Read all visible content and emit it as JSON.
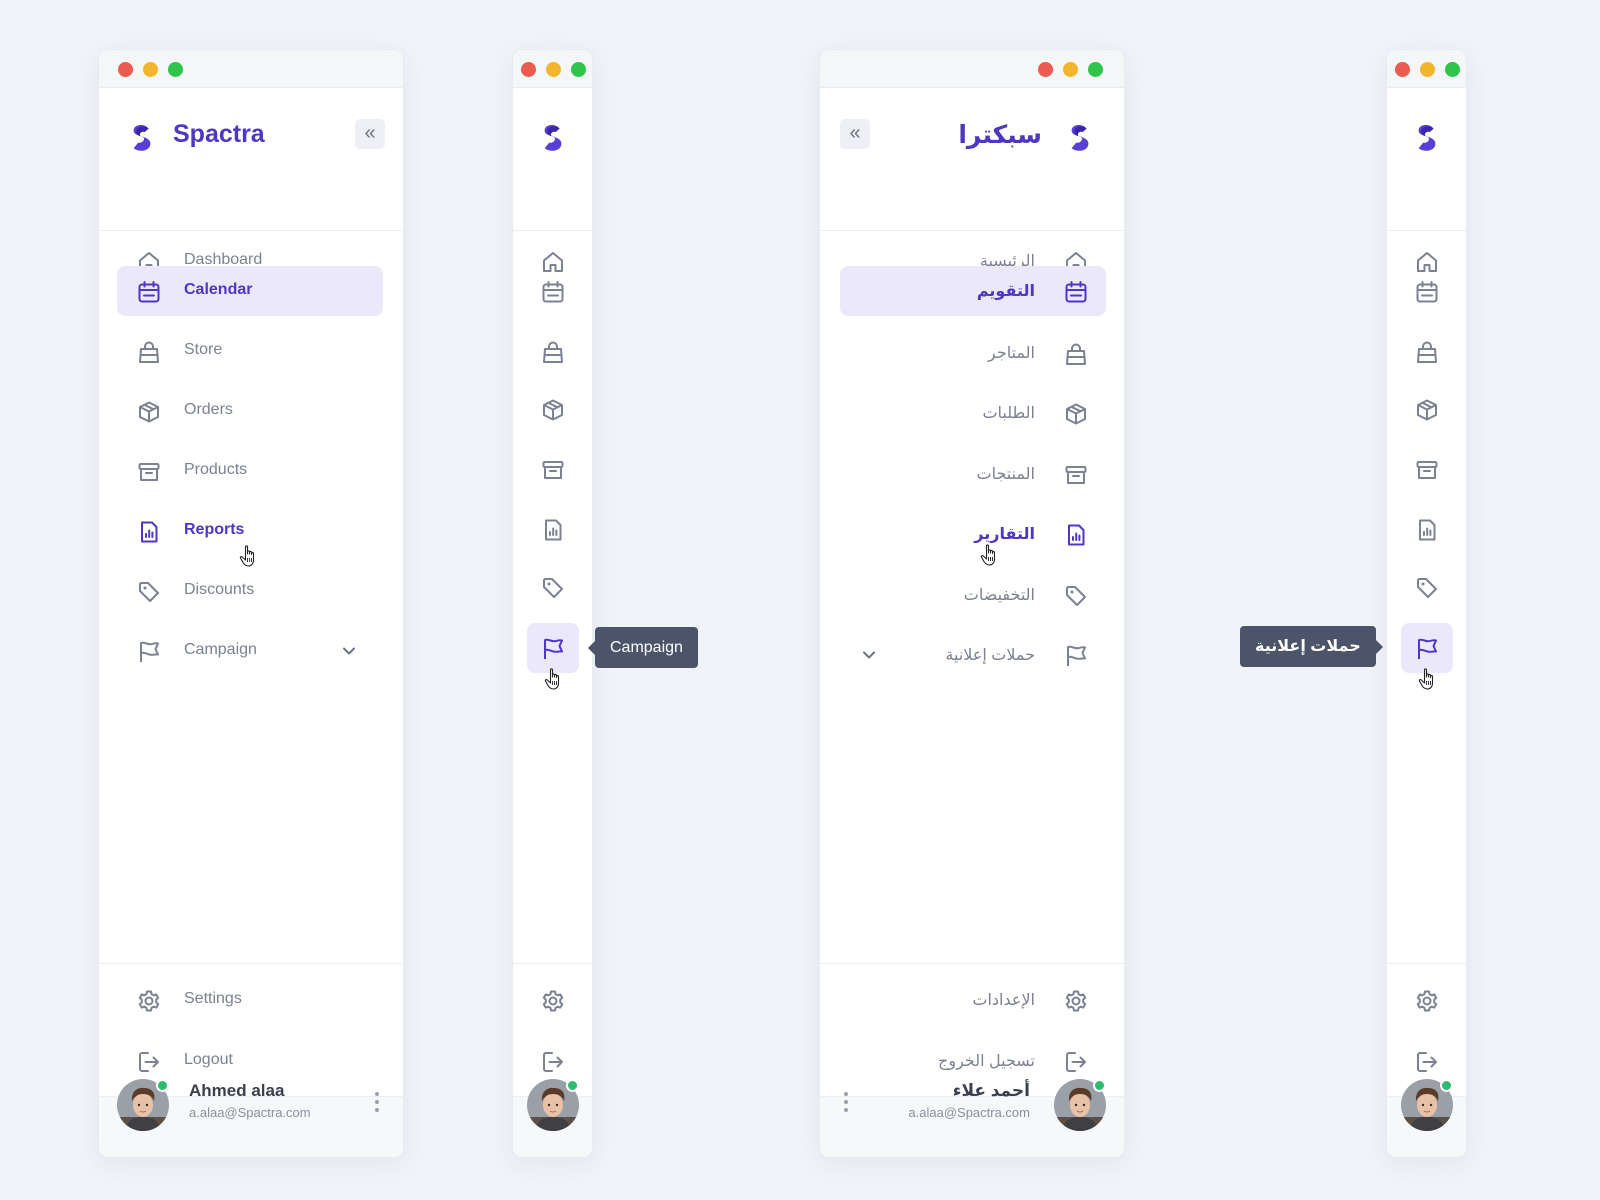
{
  "colors": {
    "accent": "#4c38c4",
    "active_bg": "#ebe8fc",
    "text_muted": "#7c8193",
    "online": "#2bbd6b",
    "tooltip_bg": "#4b5468"
  },
  "en": {
    "brand": "Spactra",
    "nav": [
      {
        "label": "Dashboard",
        "icon": "home-icon"
      },
      {
        "label": "Calendar",
        "icon": "calendar-icon"
      },
      {
        "label": "Store",
        "icon": "shopping-bag-icon"
      },
      {
        "label": "Orders",
        "icon": "box-icon"
      },
      {
        "label": "Products",
        "icon": "archive-icon"
      },
      {
        "label": "Reports",
        "icon": "report-icon"
      },
      {
        "label": "Discounts",
        "icon": "tag-icon"
      },
      {
        "label": "Campaign",
        "icon": "flag-icon"
      }
    ],
    "footer": [
      {
        "label": "Settings",
        "icon": "gear-icon"
      },
      {
        "label": "Logout",
        "icon": "logout-icon"
      }
    ],
    "user": {
      "name": "Ahmed alaa",
      "email": "a.alaa@Spactra.com"
    },
    "tooltip": "Campaign"
  },
  "ar": {
    "brand": "سبكترا",
    "nav": [
      {
        "label": "الرئيسية",
        "icon": "home-icon"
      },
      {
        "label": "التقويم",
        "icon": "calendar-icon"
      },
      {
        "label": "المتاجر",
        "icon": "shopping-bag-icon"
      },
      {
        "label": "الطلبات",
        "icon": "box-icon"
      },
      {
        "label": "المنتجات",
        "icon": "archive-icon"
      },
      {
        "label": "التقارير",
        "icon": "report-icon"
      },
      {
        "label": "التخفيضات",
        "icon": "tag-icon"
      },
      {
        "label": "حملات إعلانية",
        "icon": "flag-icon"
      }
    ],
    "footer": [
      {
        "label": "الإعدادات",
        "icon": "gear-icon"
      },
      {
        "label": "تسجيل الخروج",
        "icon": "logout-icon"
      }
    ],
    "user": {
      "name": "أحمد علاء",
      "email": "a.alaa@Spactra.com"
    },
    "tooltip": "حملات إعلانية"
  },
  "state": {
    "active_item": "Calendar",
    "hovered_item": "Reports",
    "collapsed_hover": "Campaign"
  }
}
